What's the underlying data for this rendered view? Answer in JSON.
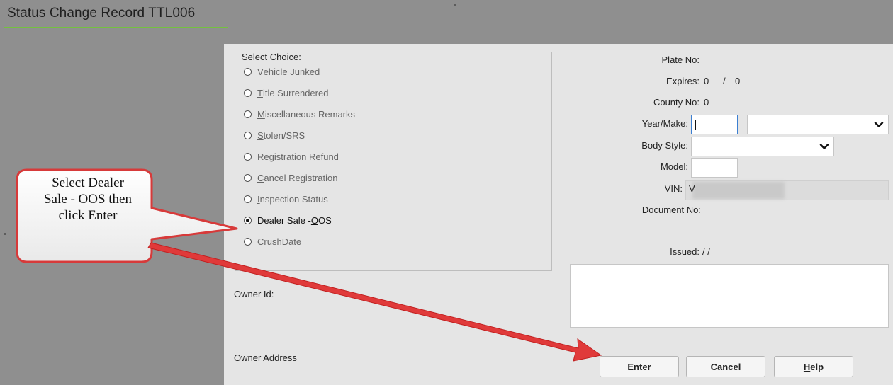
{
  "window": {
    "title": "Status Change Record TTL006"
  },
  "choices": {
    "legend": "Select Choice:",
    "options": [
      {
        "prefix": "",
        "key": "V",
        "rest": "ehicle Junked",
        "selected": false
      },
      {
        "prefix": "",
        "key": "T",
        "rest": "itle Surrendered",
        "selected": false
      },
      {
        "prefix": "",
        "key": "M",
        "rest": "iscellaneous Remarks",
        "selected": false
      },
      {
        "prefix": "",
        "key": "S",
        "rest": "tolen/SRS",
        "selected": false
      },
      {
        "prefix": "",
        "key": "R",
        "rest": "egistration Refund",
        "selected": false
      },
      {
        "prefix": "",
        "key": "C",
        "rest": "ancel Registration",
        "selected": false
      },
      {
        "prefix": "",
        "key": "I",
        "rest": "nspection Status",
        "selected": false
      },
      {
        "prefix": "Dealer Sale - ",
        "key": "O",
        "rest": "OS",
        "selected": true
      },
      {
        "prefix": "Crush ",
        "key": "D",
        "rest": "ate",
        "selected": false
      }
    ]
  },
  "fields": {
    "plate_label": "Plate No:",
    "expires_label": "Expires:",
    "expires_month": "0",
    "expires_sep": "/",
    "expires_year": "0",
    "county_label": "County No:",
    "county_value": "0",
    "year_make_label": "Year/Make:",
    "year_value": "",
    "make_value": "",
    "body_style_label": "Body Style:",
    "body_style_value": "",
    "model_label": "Model:",
    "model_value": "",
    "vin_label": "VIN:",
    "vin_value": "V",
    "document_label": "Document No:",
    "issued_label": "Issued:",
    "issued_value": "/ /",
    "owner_id_label": "Owner Id:",
    "owner_address_label": "Owner Address"
  },
  "buttons": {
    "enter": "Enter",
    "cancel": "Cancel",
    "help_key": "H",
    "help_rest": "elp"
  },
  "callout": {
    "lines": [
      "Select Dealer",
      "Sale - OOS then",
      "click Enter"
    ],
    "color": "#e03a3a"
  }
}
